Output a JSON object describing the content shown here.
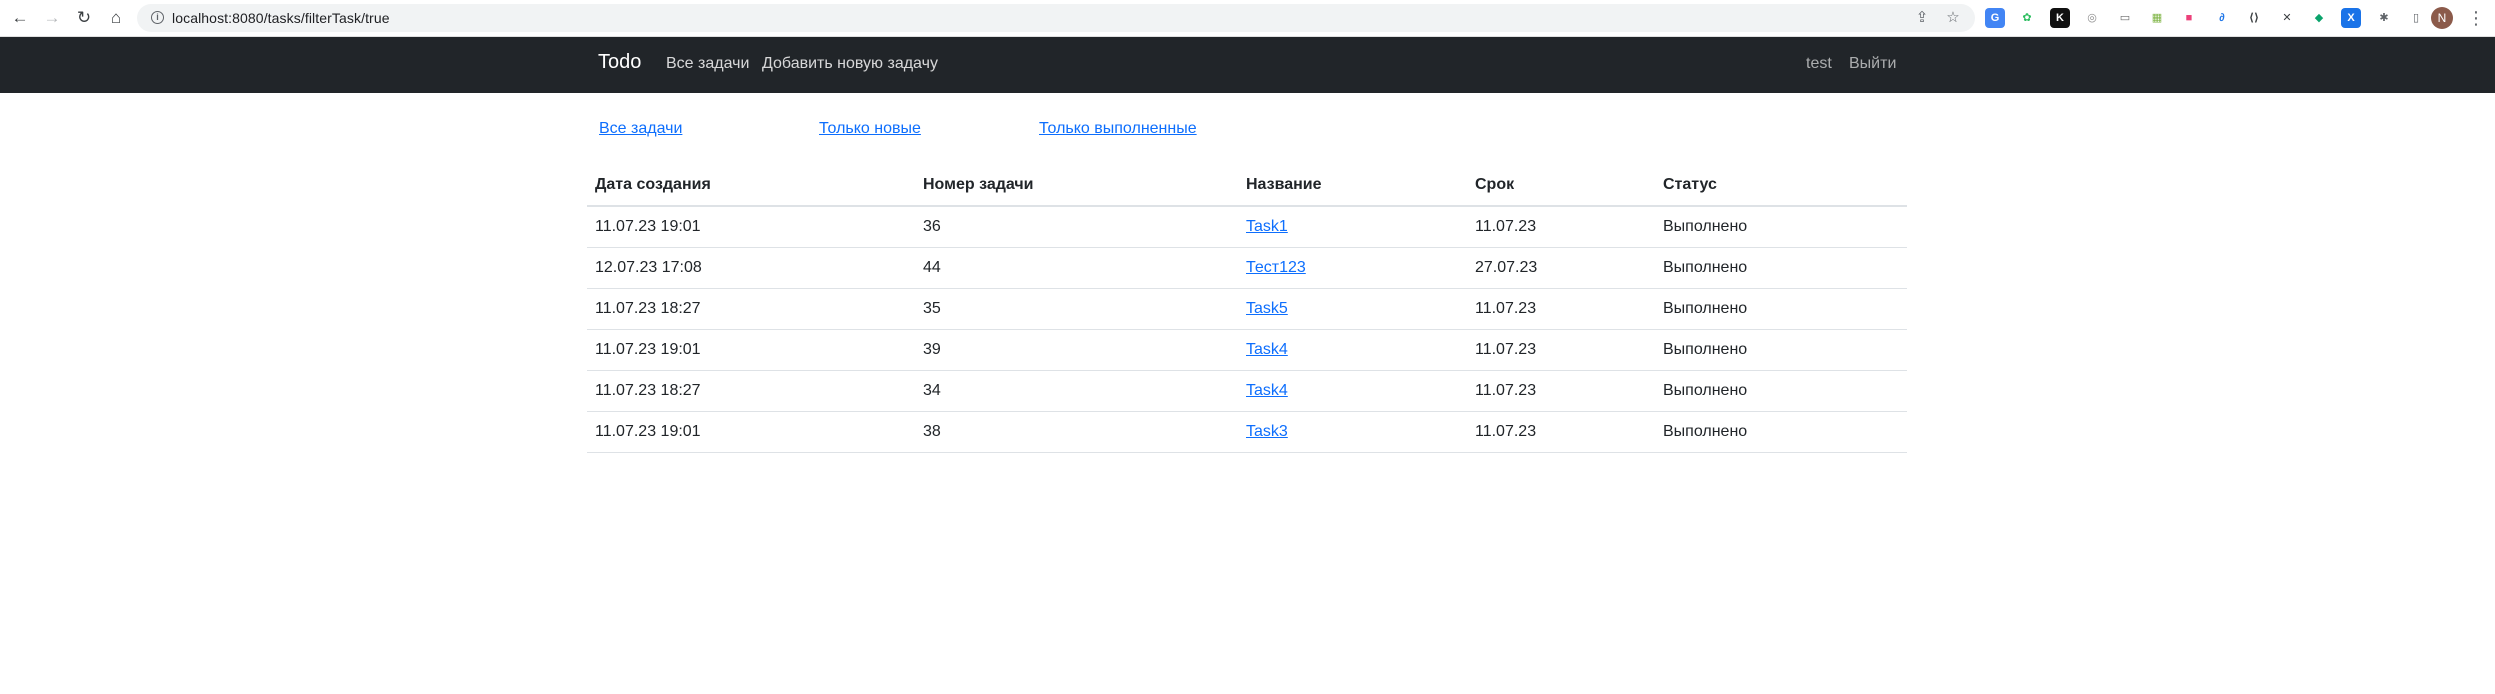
{
  "browser": {
    "url": "localhost:8080/tasks/filterTask/true",
    "profile_initial": "N",
    "extensions": [
      {
        "name": "translate-icon",
        "glyph": "G",
        "bg": "#4285f4",
        "fg": "#ffffff"
      },
      {
        "name": "evernote-icon",
        "glyph": "✿",
        "bg": "#ffffff",
        "fg": "#2dbe60"
      },
      {
        "name": "k-extension-icon",
        "glyph": "K",
        "bg": "#111111",
        "fg": "#ffffff"
      },
      {
        "name": "circle-extension-icon",
        "glyph": "◎",
        "bg": "#ffffff",
        "fg": "#8a8a8a"
      },
      {
        "name": "link-extension-icon",
        "glyph": "▭",
        "bg": "#ffffff",
        "fg": "#6a6a6a"
      },
      {
        "name": "sheet-extension-icon",
        "glyph": "▦",
        "bg": "#ffffff",
        "fg": "#7cb342"
      },
      {
        "name": "color-extension-icon",
        "glyph": "■",
        "bg": "#ffffff",
        "fg": "#ec407a"
      },
      {
        "name": "feather-extension-icon",
        "glyph": "∂",
        "bg": "#ffffff",
        "fg": "#1a73e8"
      },
      {
        "name": "code-extension-icon",
        "glyph": "⟨⟩",
        "bg": "#ffffff",
        "fg": "#3c4043"
      },
      {
        "name": "box-extension-icon",
        "glyph": "✕",
        "bg": "#ffffff",
        "fg": "#3c4043"
      },
      {
        "name": "shield-extension-icon",
        "glyph": "◆",
        "bg": "#ffffff",
        "fg": "#0aa36b"
      },
      {
        "name": "x-extension-icon",
        "glyph": "X",
        "bg": "#1a73e8",
        "fg": "#ffffff"
      },
      {
        "name": "puzzle-icon",
        "glyph": "✱",
        "bg": "#ffffff",
        "fg": "#5f6368"
      },
      {
        "name": "sidepanel-icon",
        "glyph": "▯",
        "bg": "#ffffff",
        "fg": "#5f6368"
      }
    ]
  },
  "navbar": {
    "brand": "Todo",
    "links": [
      "Все задачи",
      "Добавить новую задачу"
    ],
    "user": "test",
    "logout": "Выйти"
  },
  "filters": [
    "Все задачи",
    "Только новые",
    "Только выполненные"
  ],
  "table": {
    "headers": [
      "Дата создания",
      "Номер задачи",
      "Название",
      "Срок",
      "Статус"
    ],
    "rows": [
      {
        "created": "11.07.23 19:01",
        "number": "36",
        "title": "Task1",
        "deadline": "11.07.23",
        "status": "Выполнено"
      },
      {
        "created": "12.07.23 17:08",
        "number": "44",
        "title": "Тест123",
        "deadline": "27.07.23",
        "status": "Выполнено"
      },
      {
        "created": "11.07.23 18:27",
        "number": "35",
        "title": "Task5",
        "deadline": "11.07.23",
        "status": "Выполнено"
      },
      {
        "created": "11.07.23 19:01",
        "number": "39",
        "title": "Task4",
        "deadline": "11.07.23",
        "status": "Выполнено"
      },
      {
        "created": "11.07.23 18:27",
        "number": "34",
        "title": "Task4",
        "deadline": "11.07.23",
        "status": "Выполнено"
      },
      {
        "created": "11.07.23 19:01",
        "number": "38",
        "title": "Task3",
        "deadline": "11.07.23",
        "status": "Выполнено"
      }
    ]
  }
}
